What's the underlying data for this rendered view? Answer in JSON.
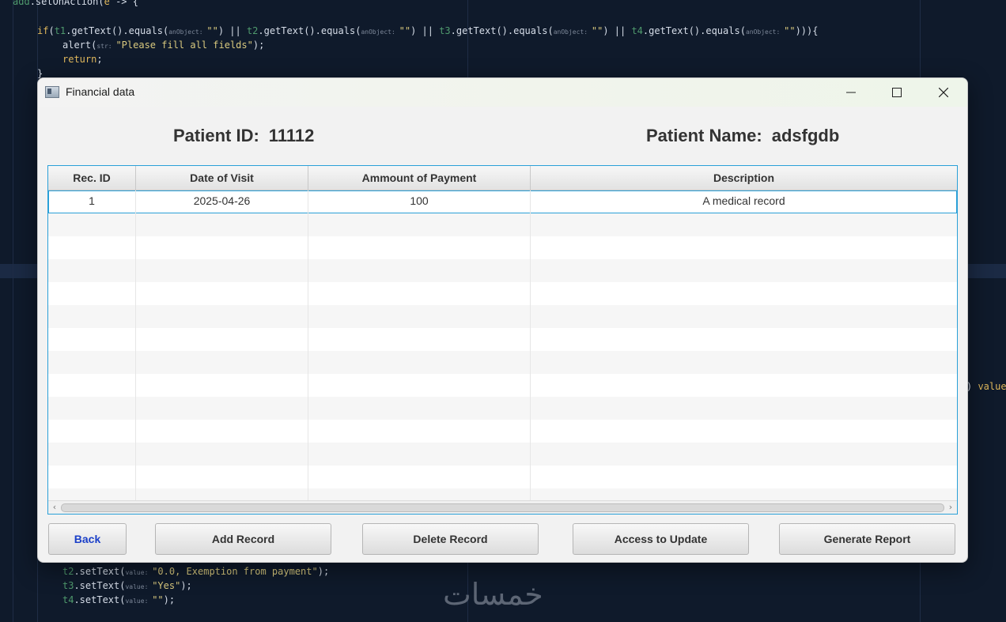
{
  "editor": {
    "lines": [
      {
        "segments": [
          [
            "var",
            "add"
          ],
          [
            "fn",
            ".setOnAction("
          ],
          [
            "kw",
            "e"
          ],
          [
            "fn",
            " -> {"
          ]
        ]
      },
      {
        "segments": [
          [
            "kw",
            "if"
          ],
          [
            "fn",
            "("
          ],
          [
            "var",
            "t1"
          ],
          [
            "fn",
            ".getText().equals("
          ],
          [
            "hint",
            "anObject: "
          ],
          [
            "str",
            "\"\""
          ],
          [
            "fn",
            ") || "
          ],
          [
            "var",
            "t2"
          ],
          [
            "fn",
            ".getText().equals("
          ],
          [
            "hint",
            "anObject: "
          ],
          [
            "str",
            "\"\""
          ],
          [
            "fn",
            ") || "
          ],
          [
            "var",
            "t3"
          ],
          [
            "fn",
            ".getText().equals("
          ],
          [
            "hint",
            "anObject: "
          ],
          [
            "str",
            "\"\""
          ],
          [
            "fn",
            ") || "
          ],
          [
            "var",
            "t4"
          ],
          [
            "fn",
            ".getText().equals("
          ],
          [
            "hint",
            "anObject: "
          ],
          [
            "str",
            "\"\""
          ],
          [
            "fn",
            "))){"
          ]
        ]
      },
      {
        "segments": [
          [
            "fn",
            "alert("
          ],
          [
            "hint",
            "str: "
          ],
          [
            "str",
            "\"Please fill all fields\""
          ],
          [
            "fn",
            ");"
          ]
        ]
      },
      {
        "segments": [
          [
            "kw",
            "return"
          ],
          [
            "fn",
            ";"
          ]
        ]
      },
      {
        "segments": [
          [
            "fn",
            "}"
          ]
        ]
      },
      {
        "segments": [
          [
            "fn",
            ") "
          ],
          [
            "kw",
            "value"
          ]
        ]
      },
      {
        "segments": [
          [
            "var",
            "t2"
          ],
          [
            "fn",
            ".setText("
          ],
          [
            "hint",
            "value: "
          ],
          [
            "str",
            "\"0.0, Exemption from payment\""
          ],
          [
            "fn",
            ");"
          ]
        ]
      },
      {
        "segments": [
          [
            "var",
            "t3"
          ],
          [
            "fn",
            ".setText("
          ],
          [
            "hint",
            "value: "
          ],
          [
            "str",
            "\"Yes\""
          ],
          [
            "fn",
            ");"
          ]
        ]
      },
      {
        "segments": [
          [
            "var",
            "t4"
          ],
          [
            "fn",
            ".setText("
          ],
          [
            "hint",
            "value: "
          ],
          [
            "str",
            "\"\""
          ],
          [
            "fn",
            ");"
          ]
        ]
      }
    ],
    "watermark": "خمسات"
  },
  "window": {
    "title": "Financial data",
    "icon": "app-window-icon",
    "controls": [
      "minimize-icon",
      "maximize-icon",
      "close-icon"
    ]
  },
  "header": {
    "patient_id_label": "Patient ID:",
    "patient_id_value": "11112",
    "patient_name_label": "Patient Name:",
    "patient_name_value": "adsfgdb"
  },
  "table": {
    "columns": [
      "Rec. ID",
      "Date of Visit",
      "Ammount of Payment",
      "Description"
    ],
    "rows": [
      [
        "1",
        "2025-04-26",
        "100",
        "A medical record"
      ]
    ],
    "selected_row": 0
  },
  "buttons": {
    "back": "Back",
    "add": "Add Record",
    "delete": "Delete Record",
    "update": "Access to Update",
    "report": "Generate Report"
  },
  "colors": {
    "accent": "#2aa0d8",
    "back_text": "#1a3fc8",
    "editor_bg": "#0f1a2b"
  }
}
